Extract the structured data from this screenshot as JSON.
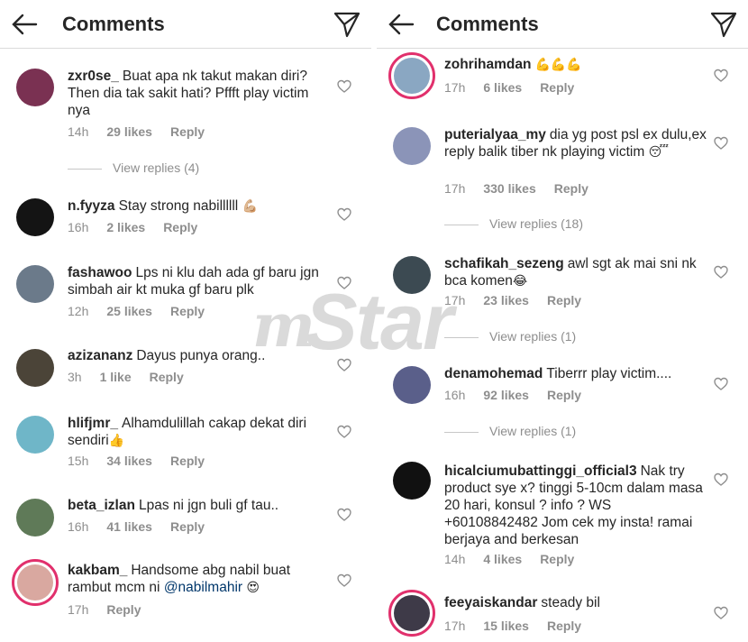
{
  "header": {
    "title": "Comments"
  },
  "watermark": {
    "m": "m",
    "text": "Star"
  },
  "left": {
    "comments": [
      {
        "username": "zxr0se_",
        "text": "Buat apa nk takut makan diri? Then dia tak sakit hati? Pffft play victim nya",
        "time": "14h",
        "likes": "29 likes",
        "reply": "Reply",
        "view_replies": "View replies (4)"
      },
      {
        "username": "n.fyyza",
        "text": "Stay strong nabillllll",
        "emoji": "💪🏼",
        "time": "16h",
        "likes": "2 likes",
        "reply": "Reply"
      },
      {
        "username": "fashawoo",
        "text": "Lps ni klu dah ada gf baru jgn simbah air kt muka gf baru plk",
        "time": "12h",
        "likes": "25 likes",
        "reply": "Reply"
      },
      {
        "username": "azizananz",
        "text": "Dayus punya orang..",
        "time": "3h",
        "likes": "1 like",
        "reply": "Reply"
      },
      {
        "username": "hlifjmr_",
        "text": "Alhamdulillah cakap dekat diri sendiri",
        "emoji": "👍",
        "time": "15h",
        "likes": "34 likes",
        "reply": "Reply"
      },
      {
        "username": "beta_izlan",
        "text": "Lpas ni jgn buli gf tau..",
        "time": "16h",
        "likes": "41 likes",
        "reply": "Reply"
      },
      {
        "username": "kakbam_",
        "text": "Handsome abg nabil buat rambut mcm ni",
        "mention": "@nabilmahir",
        "emoji": "😍",
        "time": "17h",
        "likes": "",
        "reply": "Reply"
      }
    ]
  },
  "right": {
    "comments": [
      {
        "username": "zohrihamdan",
        "text": "",
        "emoji": "💪💪💪",
        "time": "17h",
        "likes": "6 likes",
        "reply": "Reply"
      },
      {
        "username": "puterialyaa_my",
        "text": "dia yg post psl ex dulu,ex reply balik tiber nk playing victim",
        "emoji": "😴",
        "time": "17h",
        "likes": "330 likes",
        "reply": "Reply",
        "view_replies": "View replies (18)"
      },
      {
        "username": "schafikah_sezeng",
        "text": "awl sgt ak mai sni nk bca komen",
        "emoji": "😂",
        "time": "17h",
        "likes": "23 likes",
        "reply": "Reply",
        "view_replies": "View replies (1)"
      },
      {
        "username": "denamohemad",
        "text": "Tiberrr play victim....",
        "time": "16h",
        "likes": "92 likes",
        "reply": "Reply",
        "view_replies": "View replies (1)"
      },
      {
        "username": "hicalciumubattinggi_official3",
        "text": "Nak try product sye x? tinggi 5-10cm dalam masa 20 hari, konsul ? info ? WS +60108842482 Jom cek my insta! ramai berjaya and berkesan",
        "time": "14h",
        "likes": "4 likes",
        "reply": "Reply"
      },
      {
        "username": "feeyaiskandar",
        "text": "steady bil",
        "time": "17h",
        "likes": "15 likes",
        "reply": "Reply"
      }
    ]
  },
  "icons": {
    "back": "back-arrow-icon",
    "send": "send-icon",
    "heart": "heart-outline-icon"
  }
}
